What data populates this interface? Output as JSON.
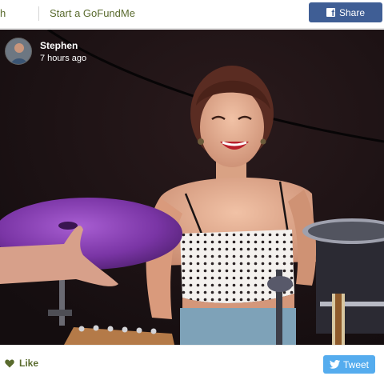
{
  "header": {
    "nav_fragment": "h",
    "start_link": "Start a GoFundMe",
    "share_label": "Share",
    "share_icon": "facebook-icon",
    "share_color": "#3f5e95"
  },
  "post": {
    "author_name": "Stephen",
    "timestamp": "7 hours ago",
    "avatar_icon": "avatar"
  },
  "footer": {
    "like_label": "Like",
    "like_icon": "heart-icon",
    "tweet_label": "Tweet",
    "tweet_icon": "twitter-bird-icon",
    "tweet_color": "#55acee",
    "accent_color": "#5a6b2e"
  }
}
